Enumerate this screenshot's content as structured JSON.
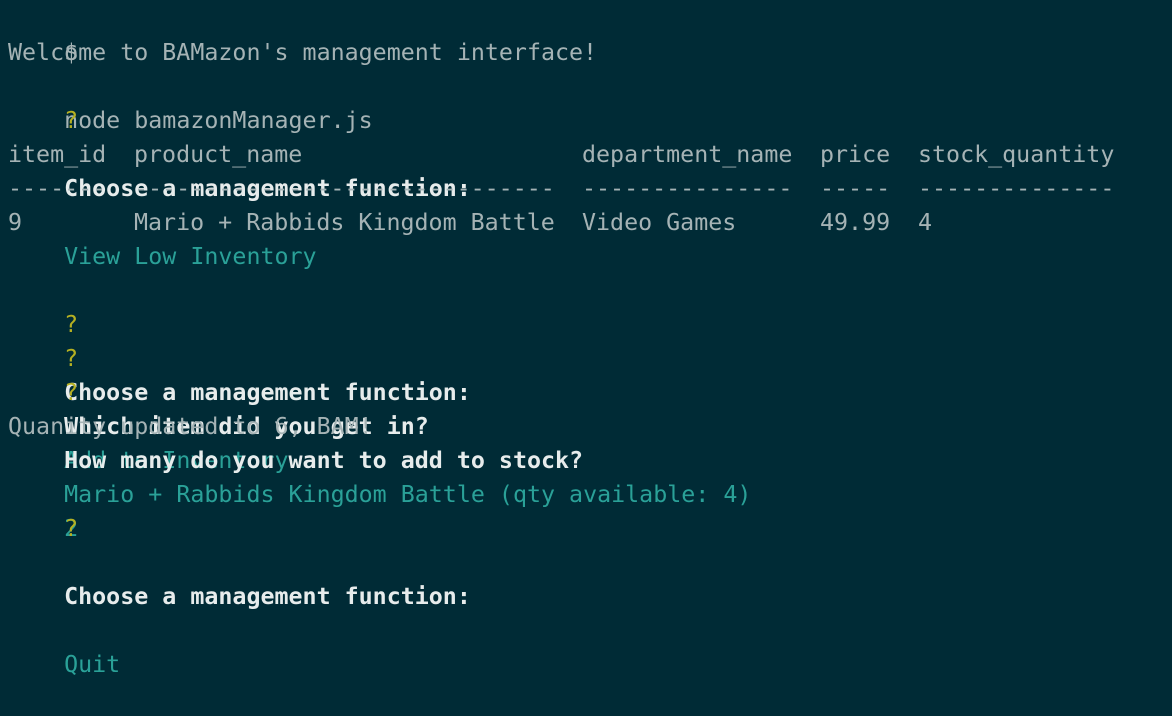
{
  "command": {
    "prompt_symbol": "$",
    "text": "node bamazonManager.js"
  },
  "welcome": "Welcome to BAMazon's management interface!",
  "prompts": [
    {
      "mark": "?",
      "question": "Choose a management function:",
      "answer": "View Low Inventory"
    },
    {
      "mark": "?",
      "question": "Choose a management function:",
      "answer": "Add to Inventory"
    },
    {
      "mark": "?",
      "question": "Which item did you get in?",
      "answer": "Mario + Rabbids Kingdom Battle (qty available: 4)"
    },
    {
      "mark": "?",
      "question": "How many do you want to add to stock?",
      "answer": "2"
    },
    {
      "mark": "?",
      "question": "Choose a management function:",
      "answer": "Quit"
    }
  ],
  "table": {
    "headers": [
      "item_id",
      "product_name",
      "department_name",
      "price",
      "stock_quantity"
    ],
    "separators": [
      "-------",
      "------------------------------",
      "---------------",
      "-----",
      "--------------"
    ],
    "rows": [
      [
        "9",
        "Mario + Rabbids Kingdom Battle",
        "Video Games",
        "49.99",
        "4"
      ]
    ]
  },
  "status_message": "Quanity updated to 6, BAM!",
  "colors": {
    "background": "#002b36",
    "text": "#a5b3b5",
    "bold_text": "#e7ecec",
    "question_mark": "#b5b022",
    "answer": "#2aa198"
  }
}
